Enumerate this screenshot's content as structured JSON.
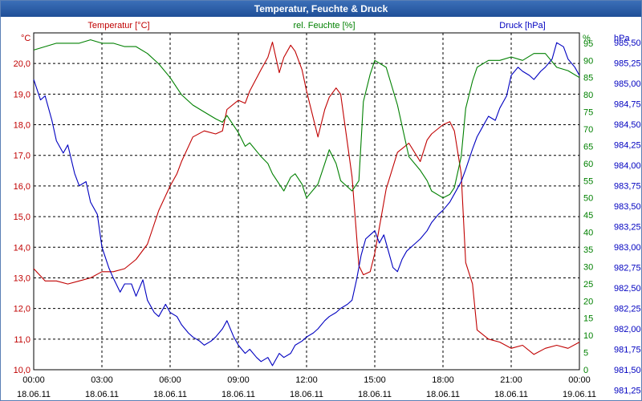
{
  "window": {
    "title": "Temperatur, Feuchte & Druck"
  },
  "chart_data": {
    "type": "line",
    "title": "Temperatur, Feuchte & Druck",
    "axes": {
      "left": {
        "unit": "°C",
        "min": 10.0,
        "max": 21.0,
        "ticks": [
          "10,0",
          "11,0",
          "12,0",
          "13,0",
          "14,0",
          "15,0",
          "16,0",
          "17,0",
          "18,0",
          "19,0",
          "20,0"
        ],
        "color": "#c00000"
      },
      "right1": {
        "unit": "%",
        "min": 0,
        "max": 98,
        "ticks": [
          "0",
          "5",
          "10",
          "15",
          "20",
          "25",
          "30",
          "35",
          "40",
          "45",
          "50",
          "55",
          "60",
          "65",
          "70",
          "75",
          "80",
          "85",
          "90",
          "95"
        ],
        "color": "#008000"
      },
      "right2": {
        "unit": "hPa",
        "min": 981.5,
        "max": 985.62,
        "ticks": [
          "981,25",
          "981,50",
          "981,75",
          "982,00",
          "982,25",
          "982,50",
          "982,75",
          "983,00",
          "983,25",
          "983,50",
          "983,75",
          "984,00",
          "984,25",
          "984,50",
          "984,75",
          "985,00",
          "985,25",
          "985,50"
        ],
        "color": "#0000c0"
      }
    },
    "x_ticks": [
      {
        "time": "00:00",
        "date": "18.06.11"
      },
      {
        "time": "03:00",
        "date": "18.06.11"
      },
      {
        "time": "06:00",
        "date": "18.06.11"
      },
      {
        "time": "09:00",
        "date": "18.06.11"
      },
      {
        "time": "12:00",
        "date": "18.06.11"
      },
      {
        "time": "15:00",
        "date": "18.06.11"
      },
      {
        "time": "18:00",
        "date": "18.06.11"
      },
      {
        "time": "21:00",
        "date": "18.06.11"
      },
      {
        "time": "00:00",
        "date": "19.06.11"
      }
    ],
    "x_range_hours": [
      0,
      24
    ],
    "grid": true,
    "series": [
      {
        "name": "Temperatur [°C]",
        "axis": "left",
        "color": "#c00000",
        "x": [
          0,
          0.5,
          1,
          1.5,
          2,
          2.5,
          3,
          3.5,
          4,
          4.5,
          5,
          5.5,
          6,
          6.3,
          6.5,
          7,
          7.5,
          8,
          8.3,
          8.5,
          9,
          9.3,
          9.5,
          10,
          10.3,
          10.5,
          10.8,
          11,
          11.3,
          11.5,
          11.8,
          12,
          12.5,
          12.8,
          13,
          13.3,
          13.5,
          14,
          14.3,
          14.5,
          14.8,
          15,
          15.5,
          16,
          16.5,
          17,
          17.3,
          17.5,
          18,
          18.3,
          18.5,
          18.8,
          19,
          19.3,
          19.5,
          20,
          20.5,
          21,
          21.5,
          22,
          22.5,
          23,
          23.5,
          24
        ],
        "y": [
          13.3,
          12.9,
          12.9,
          12.8,
          12.9,
          13.0,
          13.2,
          13.2,
          13.3,
          13.6,
          14.1,
          15.2,
          16.0,
          16.4,
          16.8,
          17.6,
          17.8,
          17.7,
          17.8,
          18.5,
          18.8,
          18.7,
          19.1,
          19.8,
          20.2,
          20.7,
          19.7,
          20.2,
          20.6,
          20.4,
          19.8,
          19.1,
          17.6,
          18.5,
          18.9,
          19.2,
          19.0,
          16.3,
          13.4,
          13.1,
          13.2,
          13.8,
          15.9,
          17.1,
          17.4,
          16.8,
          17.5,
          17.7,
          18.0,
          18.1,
          17.8,
          16.4,
          13.5,
          12.8,
          11.3,
          11.0,
          10.9,
          10.7,
          10.8,
          10.5,
          10.7,
          10.8,
          10.7,
          10.9
        ]
      },
      {
        "name": "rel. Feuchte [%]",
        "axis": "right1",
        "color": "#008000",
        "x": [
          0,
          0.5,
          1,
          1.5,
          2,
          2.5,
          3,
          3.5,
          4,
          4.5,
          5,
          5.5,
          6,
          6.3,
          6.5,
          7,
          7.5,
          8,
          8.3,
          8.5,
          9,
          9.3,
          9.5,
          10,
          10.3,
          10.5,
          10.8,
          11,
          11.3,
          11.5,
          11.8,
          12,
          12.5,
          12.8,
          13,
          13.3,
          13.5,
          14,
          14.3,
          14.5,
          14.8,
          15,
          15.5,
          16,
          16.5,
          17,
          17.3,
          17.5,
          18,
          18.3,
          18.5,
          18.8,
          19,
          19.3,
          19.5,
          20,
          20.5,
          21,
          21.5,
          22,
          22.5,
          23,
          23.5,
          24
        ],
        "y": [
          93,
          94,
          95,
          95,
          95,
          96,
          95,
          95,
          94,
          94,
          92,
          89,
          85,
          82,
          80,
          77,
          75,
          73,
          72,
          74,
          69,
          65,
          66,
          62,
          60,
          57,
          54,
          52,
          56,
          57,
          54,
          50,
          54,
          60,
          64,
          60,
          55,
          52,
          55,
          78,
          86,
          90,
          88,
          77,
          62,
          58,
          55,
          52,
          50,
          51,
          53,
          62,
          76,
          84,
          88,
          90,
          90,
          91,
          90,
          92,
          92,
          88,
          87,
          85
        ],
        "note": ""
      },
      {
        "name": "Druck [hPa]",
        "axis": "right2",
        "color": "#0000c0",
        "x": [
          0,
          0.3,
          0.5,
          0.8,
          1,
          1.3,
          1.5,
          1.8,
          2,
          2.3,
          2.5,
          2.8,
          3,
          3.3,
          3.5,
          3.8,
          4,
          4.3,
          4.5,
          4.8,
          5,
          5.3,
          5.5,
          5.8,
          6,
          6.3,
          6.5,
          6.8,
          7,
          7.3,
          7.5,
          7.8,
          8,
          8.3,
          8.5,
          8.8,
          9,
          9.3,
          9.5,
          9.8,
          10,
          10.3,
          10.5,
          10.8,
          11,
          11.3,
          11.5,
          11.8,
          12,
          12.3,
          12.5,
          12.8,
          13,
          13.3,
          13.5,
          13.8,
          14,
          14.2,
          14.4,
          14.6,
          14.8,
          15,
          15.2,
          15.4,
          15.6,
          15.8,
          16,
          16.2,
          16.4,
          16.6,
          16.8,
          17,
          17.3,
          17.5,
          17.8,
          18,
          18.3,
          18.5,
          18.8,
          19,
          19.3,
          19.5,
          19.8,
          20,
          20.3,
          20.5,
          20.8,
          21,
          21.3,
          21.5,
          21.8,
          22,
          22.3,
          22.5,
          22.8,
          23,
          23.3,
          23.5,
          23.8,
          24
        ],
        "y": [
          985.05,
          984.8,
          984.85,
          984.55,
          984.3,
          984.15,
          984.25,
          983.9,
          983.75,
          983.8,
          983.55,
          983.4,
          983.0,
          982.75,
          982.62,
          982.45,
          982.55,
          982.55,
          982.4,
          982.6,
          982.35,
          982.2,
          982.15,
          982.3,
          982.2,
          982.15,
          982.05,
          981.95,
          981.9,
          981.85,
          981.8,
          981.85,
          981.9,
          982.0,
          982.1,
          981.9,
          981.8,
          981.7,
          981.75,
          981.65,
          981.6,
          981.65,
          981.55,
          981.7,
          981.65,
          981.7,
          981.8,
          981.85,
          981.9,
          981.95,
          982.0,
          982.1,
          982.15,
          982.2,
          982.25,
          982.3,
          982.35,
          982.6,
          982.9,
          983.1,
          983.15,
          983.2,
          983.05,
          983.15,
          982.95,
          982.75,
          982.7,
          982.85,
          982.95,
          983.0,
          983.05,
          983.1,
          983.2,
          983.3,
          983.4,
          983.45,
          983.55,
          983.65,
          983.8,
          983.95,
          984.2,
          984.35,
          984.5,
          984.6,
          984.55,
          984.7,
          984.85,
          985.1,
          985.2,
          985.15,
          985.1,
          985.05,
          985.15,
          985.2,
          985.3,
          985.5,
          985.45,
          985.3,
          985.2,
          985.1
        ]
      }
    ]
  }
}
